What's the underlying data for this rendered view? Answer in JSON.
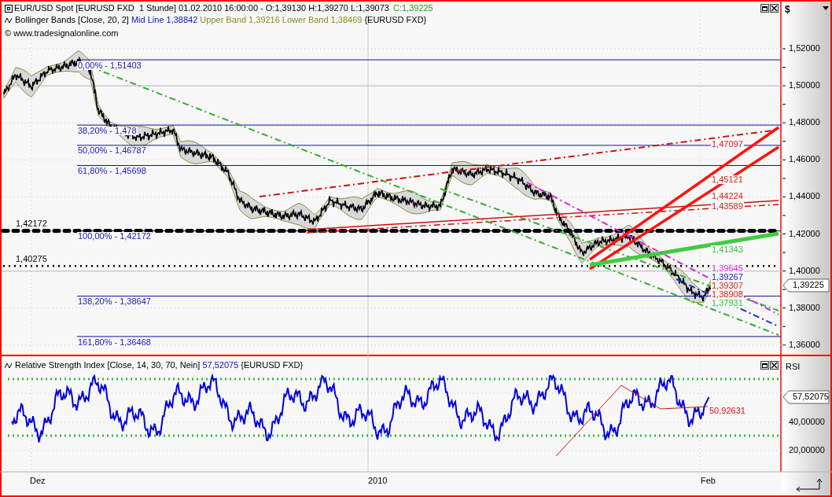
{
  "price_panel": {
    "title": "EUR/USD Spot [EURUSD FXD  1 Stunde] 01.02.2010 16:00:00 - O:1,39130 H:1,39270 L:1,39073",
    "close": "C:1,39225",
    "indicator_legend": {
      "name": "Bollinger Bands [Close, 20, 2]",
      "mid_line": "Mid Line 1,38842",
      "upper_band": "Upper Band 1,39216",
      "lower_band": "Lower Band 1,38469",
      "source": "{EURUSD FXD}"
    },
    "copyright": "© www.tradesignalonline.com",
    "fib_levels": [
      "0,00% - 1,51403",
      "38,20% - 1,478",
      "50,00% - 1,46787",
      "61,80% - 1,45698",
      "100,00% - 1,42172",
      "138,20% - 1,38647",
      "161,80% - 1,36468"
    ],
    "price_levels": [
      "1,42172",
      "1,40275"
    ],
    "trendline_labels": [
      {
        "text": "1,47097",
        "color": "#e02020"
      },
      {
        "text": "1,45121",
        "color": "#e02020"
      },
      {
        "text": "1,44224",
        "color": "#e02020"
      },
      {
        "text": "1,43589",
        "color": "#e02020"
      },
      {
        "text": "1,41343",
        "color": "#40c040"
      },
      {
        "text": "1,39645",
        "color": "#e020e0"
      },
      {
        "text": "1,39267",
        "color": "#2020c0"
      },
      {
        "text": "1,39307",
        "color": "#e02020"
      },
      {
        "text": "1,38908",
        "color": "#e02020"
      },
      {
        "text": "1,37931",
        "color": "#40c040"
      }
    ],
    "axis": {
      "currency": "$",
      "ticks": [
        "1,52000",
        "1,50000",
        "1,48000",
        "1,46000",
        "1,44000",
        "1,42000",
        "1,40000",
        "1,38000",
        "1,36000"
      ],
      "current_price": "1,39225"
    }
  },
  "rsi_panel": {
    "legend": {
      "name": "Relative Strength Index [Close, 14, 30, 70, Nein]",
      "value": "57,52075",
      "source": "{EURUSD FXD}"
    },
    "axis": {
      "title": "RSI",
      "ticks": [
        "40,00000",
        "20,00000"
      ],
      "current_value": "57,52075"
    },
    "trendline_label": "50,92631"
  },
  "time_axis": [
    "Dez",
    "2010",
    "Feb"
  ]
}
